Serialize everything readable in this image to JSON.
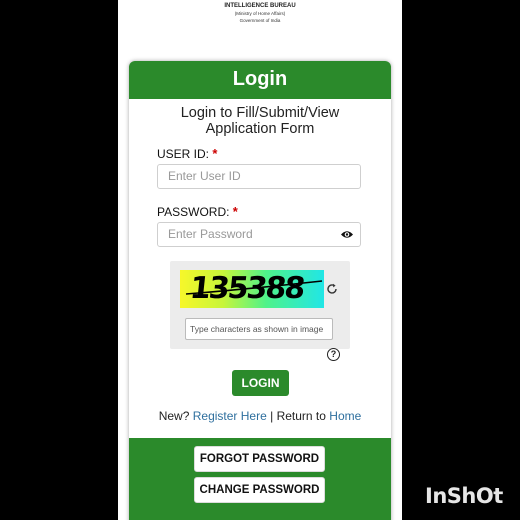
{
  "header": {
    "org_name": "INTELLIGENCE BUREAU",
    "ministry": "(Ministry of Home Affairs)",
    "government": "Government of India"
  },
  "login_card": {
    "title": "Login",
    "subtitle_line1": "Login to Fill/Submit/View",
    "subtitle_line2": "Application Form",
    "user_id_label": "USER ID:",
    "user_id_placeholder": "Enter User ID",
    "password_label": "PASSWORD:",
    "password_placeholder": "Enter Password",
    "required_marker": "*",
    "captcha_text": "135388",
    "captcha_placeholder": "Type characters as shown in image",
    "help_glyph": "?",
    "login_button": "LOGIN",
    "new_prefix": "New?",
    "register_link": "Register Here",
    "separator": "|",
    "return_text": "Return to",
    "home_link": "Home",
    "forgot_password_button": "FORGOT PASSWORD",
    "change_password_button": "CHANGE PASSWORD"
  },
  "icons": {
    "password_toggle": "eye-icon",
    "captcha_refresh": "refresh-icon",
    "captcha_help": "help-icon"
  },
  "watermark": "InShOt",
  "colors": {
    "brand_green": "#2b8a2b",
    "link_blue": "#2e6f9e",
    "required_red": "#cc0000"
  }
}
